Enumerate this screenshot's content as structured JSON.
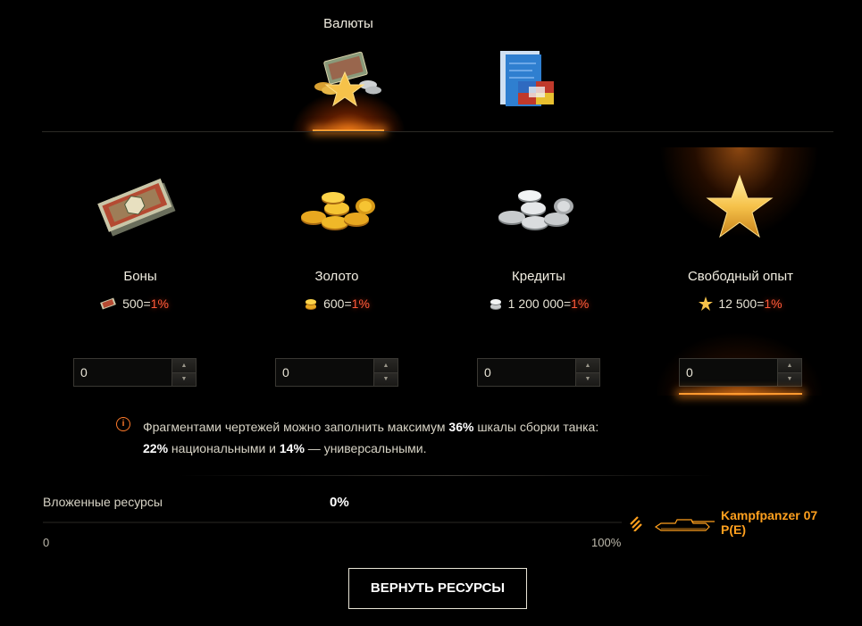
{
  "tabs": {
    "active_label": "Валюты"
  },
  "resources": [
    {
      "name": "Боны",
      "amount": "500",
      "eq": "=",
      "pct": "1%",
      "value": "0",
      "icon": "bonds-icon"
    },
    {
      "name": "Золото",
      "amount": "600",
      "eq": "=",
      "pct": "1%",
      "value": "0",
      "icon": "gold-icon"
    },
    {
      "name": "Кредиты",
      "amount": "1 200 000",
      "eq": "=",
      "pct": "1%",
      "value": "0",
      "icon": "credits-icon"
    },
    {
      "name": "Свободный опыт",
      "amount": "12 500",
      "eq": "=",
      "pct": "1%",
      "value": "0",
      "icon": "free-xp-star-icon"
    }
  ],
  "info": {
    "line1_a": "Фрагментами чертежей можно заполнить максимум ",
    "line1_b": "36%",
    "line1_c": " шкалы сборки танка:",
    "line2_a": "22%",
    "line2_b": " национальными и ",
    "line2_c": "14%",
    "line2_d": " — универсальными."
  },
  "progress": {
    "label": "Вложенные ресурсы",
    "value": "0%",
    "min": "0",
    "max": "100%",
    "fraction": 0
  },
  "tank": {
    "name_line1": "Kampfpanzer 07",
    "name_line2": "P(E)"
  },
  "return_button": "ВЕРНУТЬ РЕСУРСЫ",
  "colors": {
    "accent": "#ffa01e",
    "percent": "#ff5a3a",
    "glow": "#ff9a30"
  }
}
